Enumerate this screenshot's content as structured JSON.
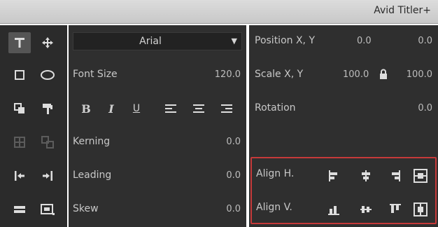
{
  "window": {
    "title": "Avid Titler+"
  },
  "tools": [
    {
      "name": "text-tool-icon",
      "active": true
    },
    {
      "name": "move-tool-icon"
    },
    {
      "name": "rectangle-tool-icon"
    },
    {
      "name": "ellipse-tool-icon"
    },
    {
      "name": "copy-style-icon"
    },
    {
      "name": "paste-style-icon"
    },
    {
      "name": "group-icon",
      "disabled": true
    },
    {
      "name": "ungroup-icon",
      "disabled": true
    },
    {
      "name": "send-back-icon"
    },
    {
      "name": "bring-front-icon"
    },
    {
      "name": "distribute-icon"
    },
    {
      "name": "safe-area-icon"
    }
  ],
  "text_panel": {
    "font": "Arial",
    "font_size_label": "Font Size",
    "font_size_value": "120.0",
    "format_buttons": [
      "B",
      "I",
      "U"
    ],
    "kerning_label": "Kerning",
    "kerning_value": "0.0",
    "leading_label": "Leading",
    "leading_value": "0.0",
    "skew_label": "Skew",
    "skew_value": "0.0"
  },
  "transform_panel": {
    "position_label": "Position X, Y",
    "position_x": "0.0",
    "position_y": "0.0",
    "scale_label": "Scale X, Y",
    "scale_x": "100.0",
    "scale_y": "100.0",
    "rotation_label": "Rotation",
    "rotation_value": "0.0",
    "align_h_label": "Align H.",
    "align_v_label": "Align V."
  },
  "colors": {
    "accent": "#c63a3a",
    "panel": "#2f2f2f",
    "text": "#c8c8c8"
  }
}
